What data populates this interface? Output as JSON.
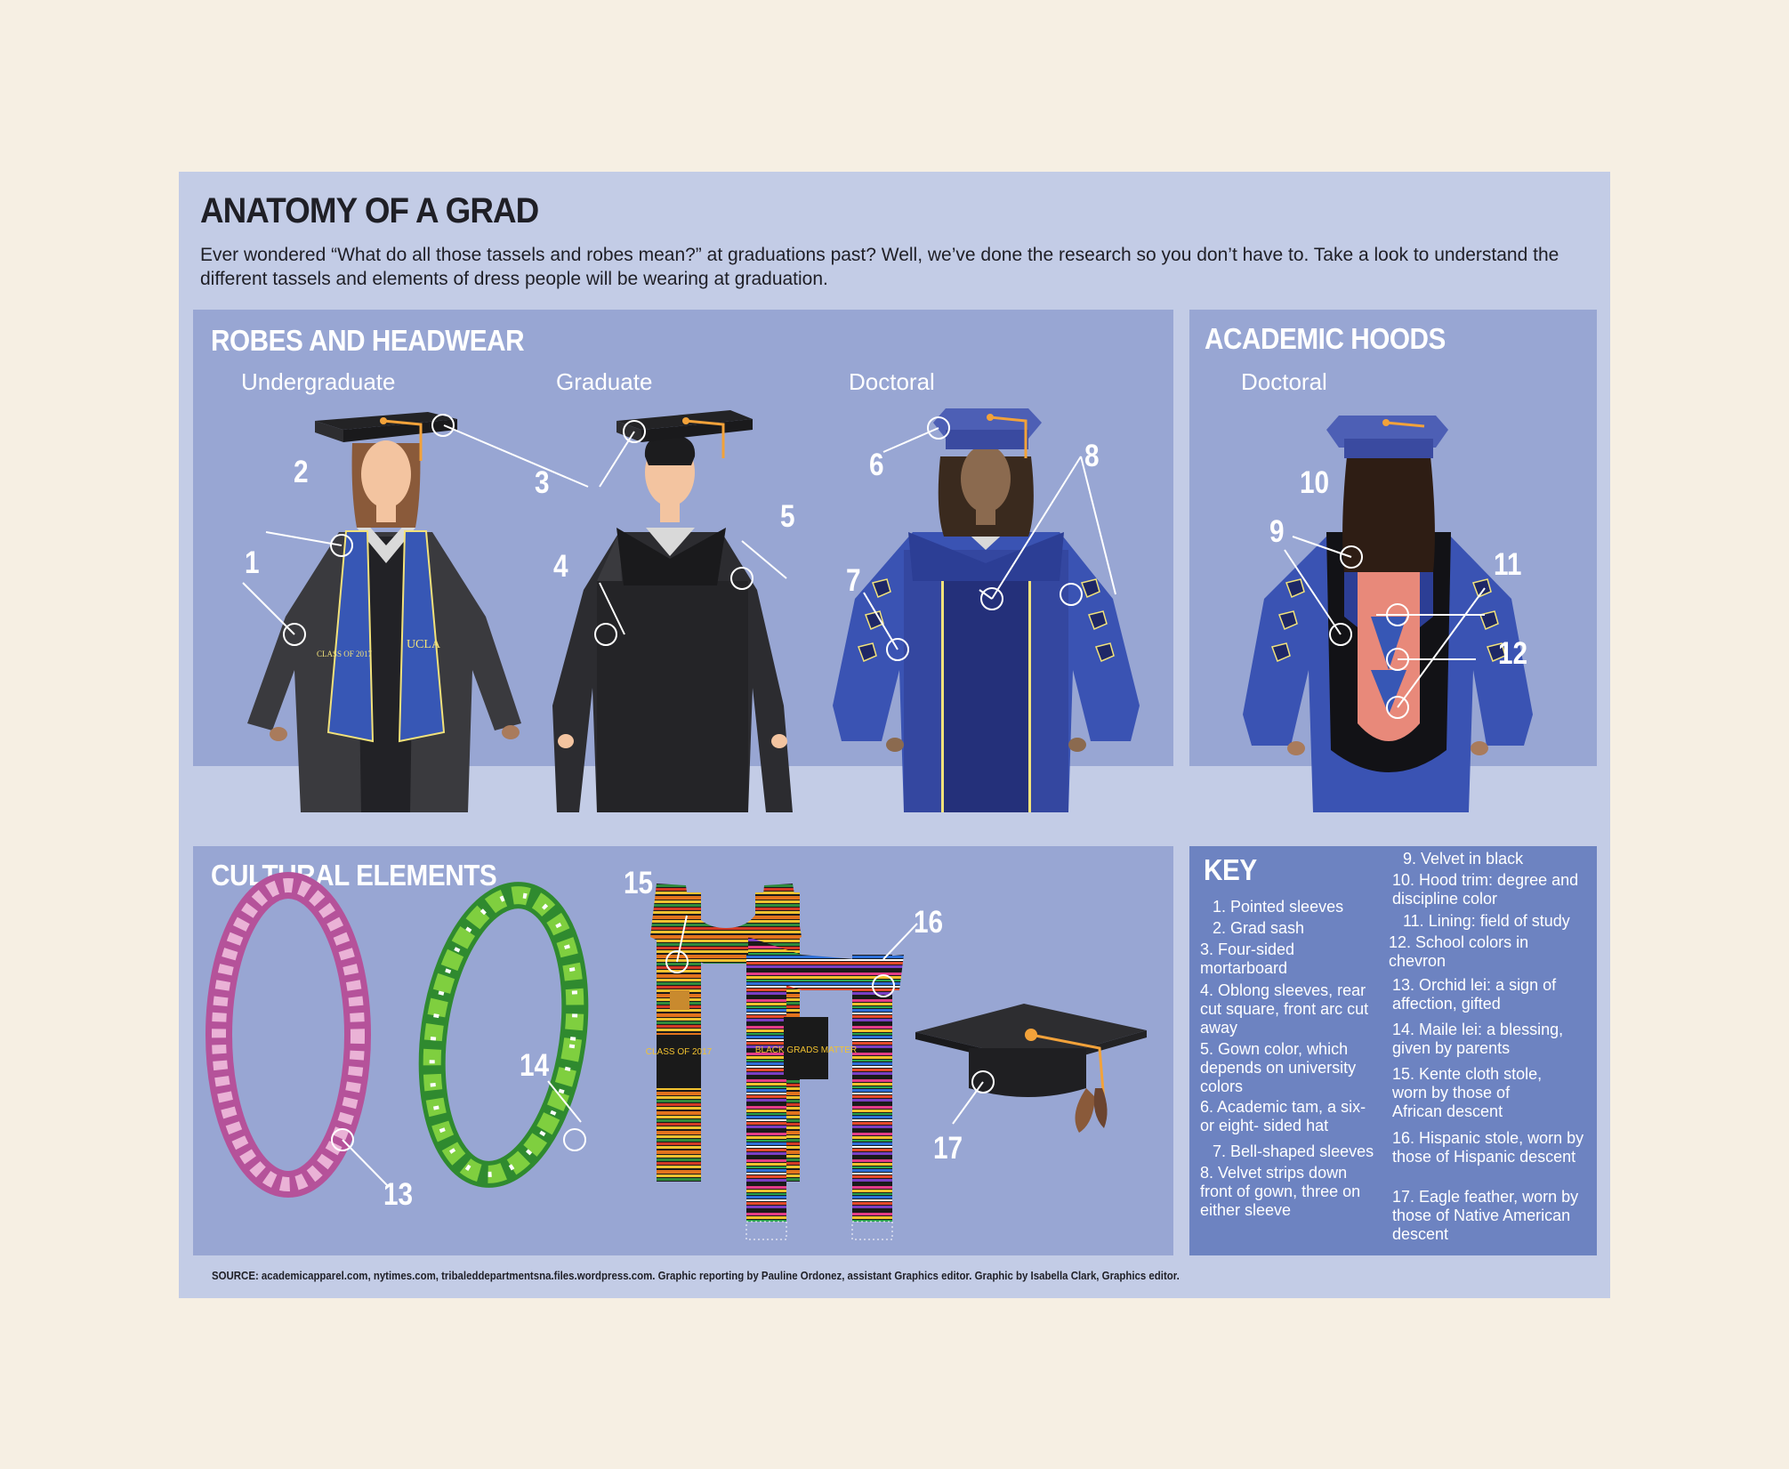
{
  "header": {
    "title": "ANATOMY OF A GRAD",
    "intro": "Ever wondered “What do all those tassels and robes mean?” at graduations past? Well, we’ve done the research so you don’t have to. Take a look to understand the different tassels and elements of dress people will be wearing at graduation."
  },
  "robes": {
    "title": "ROBES AND HEADWEAR",
    "undergrad_label": "Undergraduate",
    "grad_label": "Graduate",
    "doctoral_label": "Doctoral",
    "sash_left_text": "CLASS OF 2017",
    "sash_right_text": "UCLA"
  },
  "hoods": {
    "title": "ACADEMIC HOODS",
    "doctoral_label": "Doctoral"
  },
  "cultural": {
    "title": "CULTURAL ELEMENTS",
    "kente_text": "CLASS OF 2017",
    "stole_text": "BLACK GRADS MATTER"
  },
  "callouts": [
    "1",
    "2",
    "3",
    "4",
    "5",
    "6",
    "7",
    "8",
    "9",
    "10",
    "11",
    "12",
    "13",
    "14",
    "15",
    "16",
    "17"
  ],
  "key": {
    "title": "KEY",
    "items": [
      "1. Pointed sleeves",
      "2. Grad sash",
      "3. Four-sided mortarboard",
      "4. Oblong sleeves, rear cut square, front arc cut away",
      "5. Gown color, which depends on university colors",
      "6. Academic tam, a six- or eight- sided hat",
      "7. Bell-shaped sleeves",
      "8. Velvet strips down front of gown, three on either sleeve",
      "9. Velvet in black",
      "10. Hood trim: degree and discipline color",
      "11. Lining: field of study",
      "12. School colors in chevron",
      "13. Orchid lei: a sign of affection, gifted",
      "14. Maile lei: a blessing, given by parents",
      "15. Kente cloth stole, worn by those of African descent",
      "16. Hispanic stole, worn by those of Hispanic descent",
      "17. Eagle feather, worn by those of Native American descent"
    ]
  },
  "source": "SOURCE: academicapparel.com, nytimes.com, tribaleddepartmentsna.files.wordpress.com. Graphic reporting by Pauline Ordonez, assistant Graphics editor. Graphic by Isabella Clark, Graphics editor.",
  "colors": {
    "page_bg": "#f6efe3",
    "card_bg": "#c3cce6",
    "panel_bg": "#98a6d3",
    "key_bg": "#6d83c1",
    "gown_black": "#2c2c2f",
    "gown_blue": "#3447a0",
    "hood_pink": "#e8897a"
  }
}
